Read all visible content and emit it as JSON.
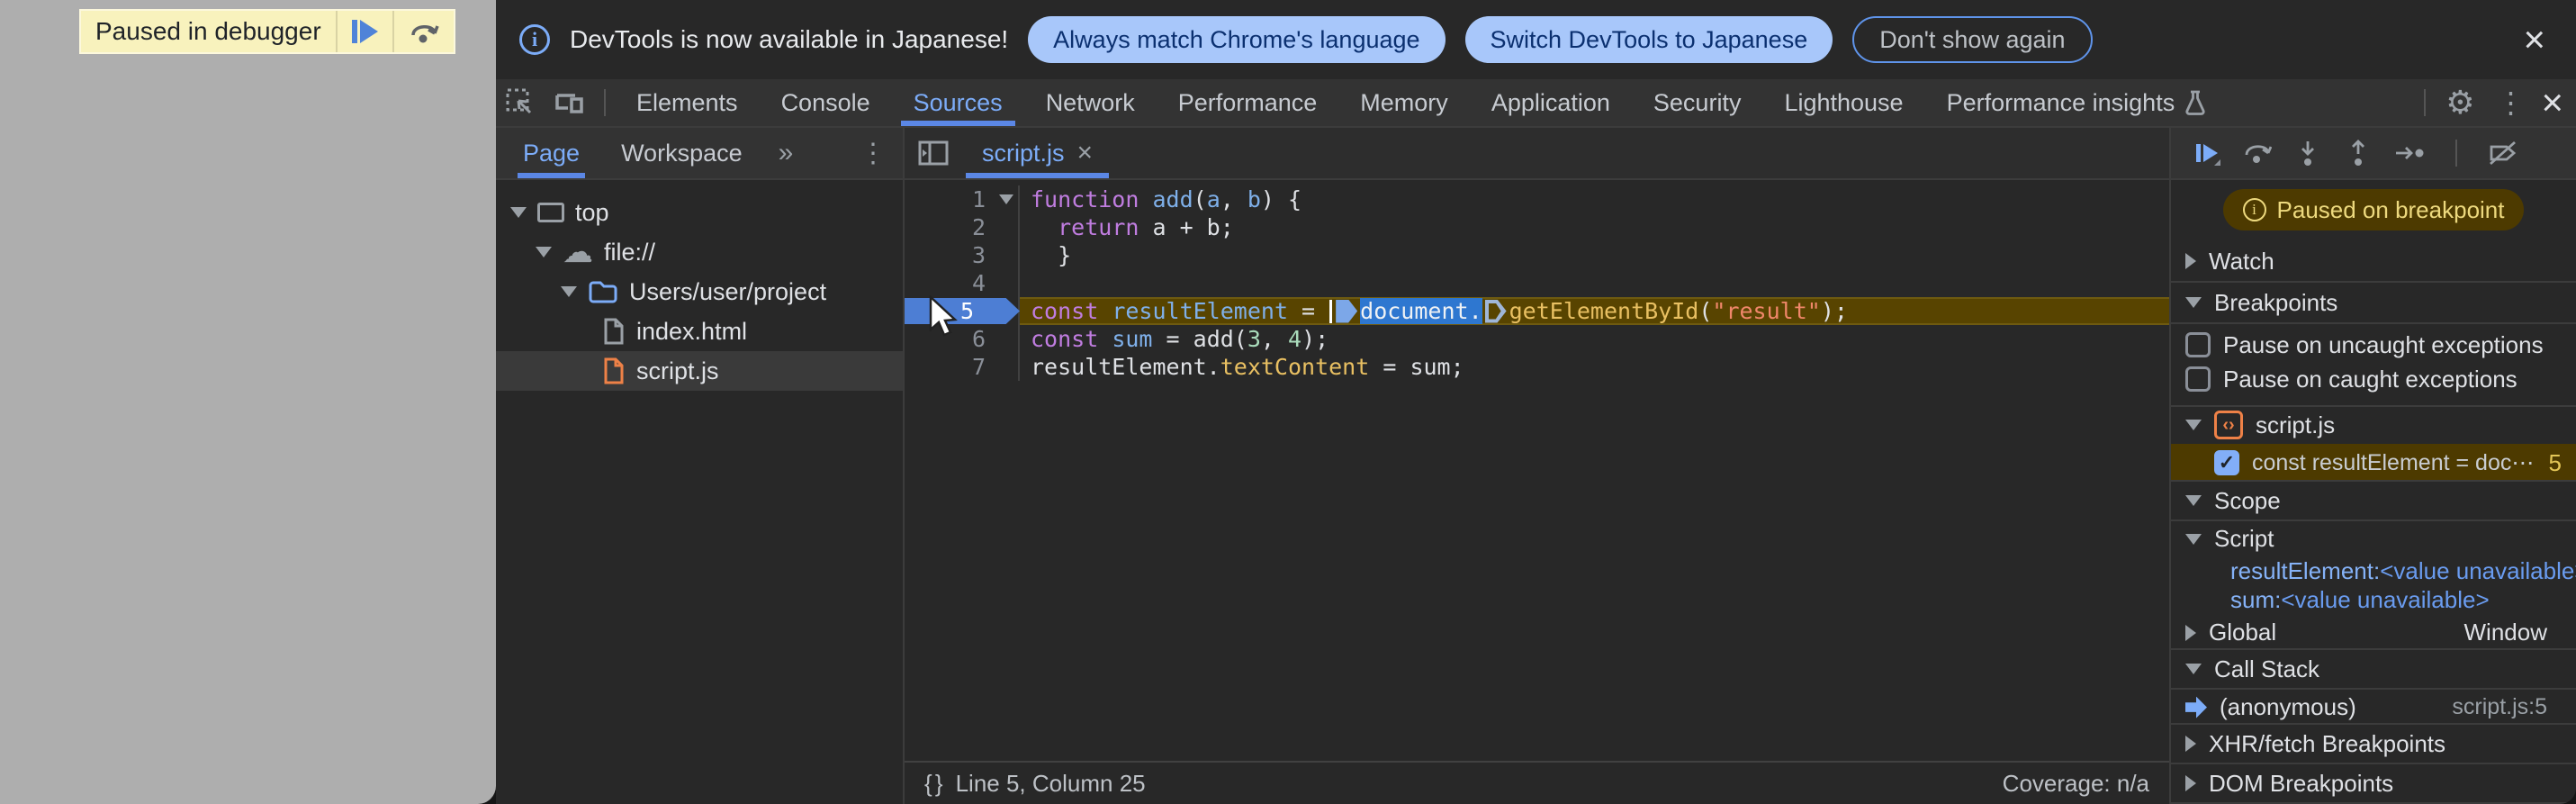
{
  "colors": {
    "accent_blue": "#7cacf8",
    "paused_olive": "#4d3a00",
    "exec_line": "#584400",
    "banner_yellow": "#f8f2bd",
    "page_gray": "#aeaeae"
  },
  "icons": {
    "gear": "⚙",
    "kebab": "⋮",
    "close": "×",
    "more_tabs": "»",
    "cloud": "☁",
    "braces": "{ }",
    "code_brackets": "‹›",
    "check": "✓",
    "info": "i"
  },
  "page_overlay": {
    "paused_label": "Paused in debugger"
  },
  "notification_bar": {
    "message": "DevTools is now available in Japanese!",
    "action_primary": "Always match Chrome's language",
    "action_secondary": "Switch DevTools to Japanese",
    "action_dismiss": "Don't show again"
  },
  "main_tabs": {
    "tabs": [
      "Elements",
      "Console",
      "Sources",
      "Network",
      "Performance",
      "Memory",
      "Application",
      "Security",
      "Lighthouse",
      "Performance insights"
    ],
    "active": "Sources"
  },
  "navigator": {
    "tab_page": "Page",
    "tab_workspace": "Workspace",
    "tree": {
      "top": "top",
      "file_scheme": "file://",
      "folder": "Users/user/project",
      "file_html": "index.html",
      "file_js": "script.js"
    }
  },
  "editor": {
    "tab_label": "script.js",
    "lines": [
      {
        "num": "1",
        "tokens": [
          "function ",
          "add",
          "(",
          "a",
          ", ",
          "b",
          ") {"
        ]
      },
      {
        "num": "2",
        "tokens": [
          "  ",
          "return",
          " a + b;"
        ]
      },
      {
        "num": "3",
        "tokens": [
          "  }"
        ]
      },
      {
        "num": "4",
        "tokens": []
      },
      {
        "num": "5",
        "tokens": [
          "const",
          " ",
          "resultElement",
          " = ",
          "document.",
          "getElementById",
          "(",
          "\"result\"",
          ");"
        ]
      },
      {
        "num": "6",
        "tokens": [
          "const",
          " ",
          "sum",
          " = add(",
          "3",
          ", ",
          "4",
          ");"
        ]
      },
      {
        "num": "7",
        "tokens": [
          "resultElement.",
          "textContent",
          " = sum;"
        ]
      }
    ],
    "status_left": "Line 5, Column 25",
    "status_right": "Coverage: n/a"
  },
  "debugger_panel": {
    "paused_message": "Paused on breakpoint",
    "watch": "Watch",
    "breakpoints": "Breakpoints",
    "pause_uncaught": "Pause on uncaught exceptions",
    "pause_caught": "Pause on caught exceptions",
    "bp_group_file": "script.js",
    "bp_entry_code": "const resultElement = doc⋯",
    "bp_entry_line": "5",
    "scope": "Scope",
    "scope_script": "Script",
    "var1_name": "resultElement: ",
    "var1_value": "<value unavailable>",
    "var2_name": "sum: ",
    "var2_value": "<value unavailable>",
    "scope_global": "Global",
    "scope_global_value": "Window",
    "call_stack": "Call Stack",
    "frame_name": "(anonymous)",
    "frame_location": "script.js:5",
    "xhr_breakpoints": "XHR/fetch Breakpoints",
    "dom_breakpoints": "DOM Breakpoints"
  }
}
